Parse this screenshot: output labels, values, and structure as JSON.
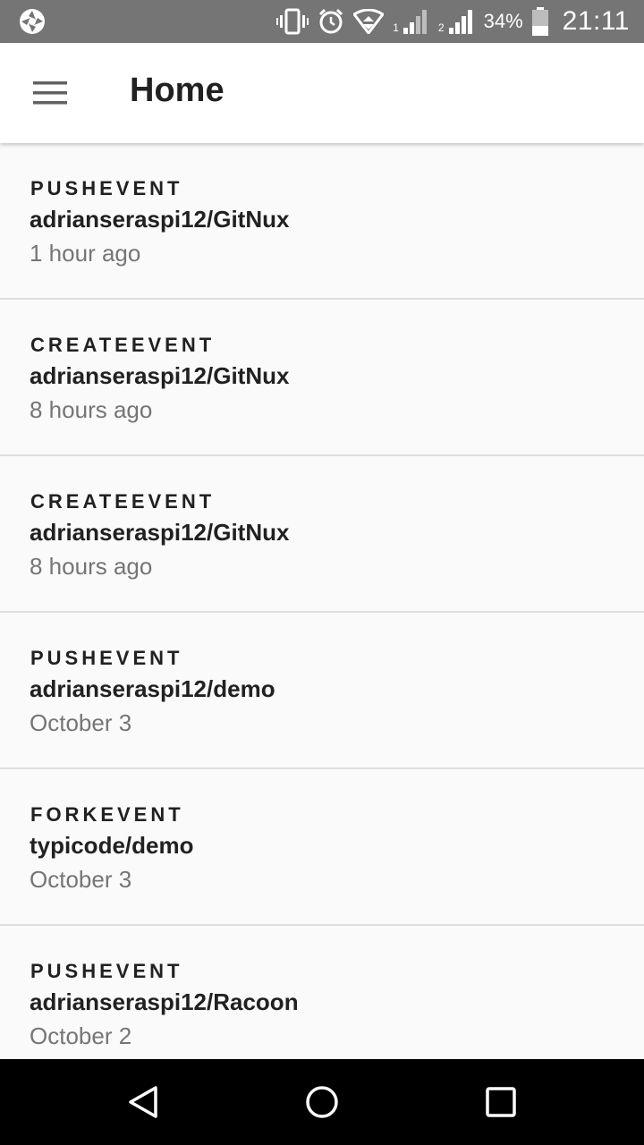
{
  "status_bar": {
    "sim1_label": "1",
    "sim2_label": "2",
    "battery": "34%",
    "time": "21:11"
  },
  "app_bar": {
    "title": "Home"
  },
  "events": [
    {
      "type": "PUSHEVENT",
      "repo": "adrianseraspi12/GitNux",
      "time": "1 hour ago"
    },
    {
      "type": "CREATEEVENT",
      "repo": "adrianseraspi12/GitNux",
      "time": "8 hours ago"
    },
    {
      "type": "CREATEEVENT",
      "repo": "adrianseraspi12/GitNux",
      "time": "8 hours ago"
    },
    {
      "type": "PUSHEVENT",
      "repo": "adrianseraspi12/demo",
      "time": "October 3"
    },
    {
      "type": "FORKEVENT",
      "repo": "typicode/demo",
      "time": "October 3"
    },
    {
      "type": "PUSHEVENT",
      "repo": "adrianseraspi12/Racoon",
      "time": "October 2"
    }
  ],
  "icons": {
    "status_left": "camera-shutter-icon",
    "vibrate": "vibrate-icon",
    "alarm": "alarm-icon",
    "wifi": "wifi-icon",
    "signal": "signal-icon",
    "battery": "battery-icon",
    "menu": "hamburger-menu-icon",
    "nav": [
      "back-icon",
      "home-icon",
      "recents-icon"
    ]
  },
  "colors": {
    "status_bar": "#757575",
    "app_bar": "#ffffff",
    "list_bg": "#fafafa",
    "primary_text": "#212121",
    "secondary_text": "#757575",
    "divider": "#dedede",
    "nav_bar": "#000000"
  }
}
